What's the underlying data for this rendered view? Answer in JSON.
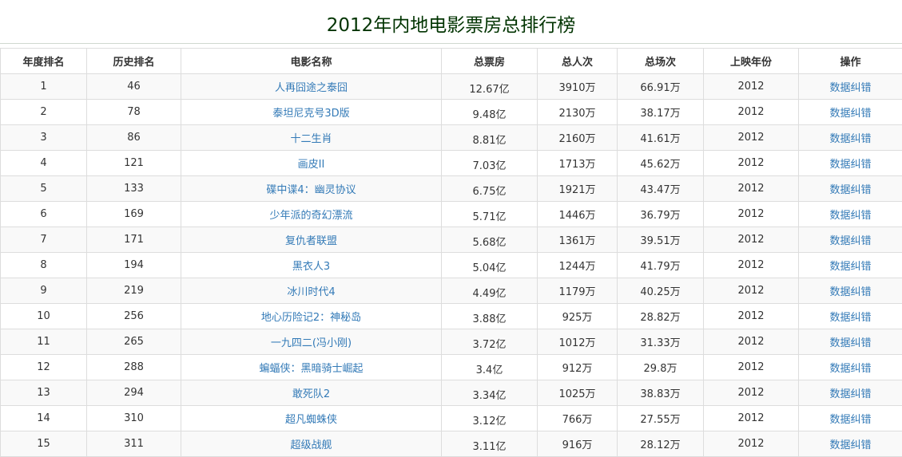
{
  "page_title": "2012年内地电影票房总排行榜",
  "headers": [
    "年度排名",
    "历史排名",
    "电影名称",
    "总票房",
    "总人次",
    "总场次",
    "上映年份",
    "操作"
  ],
  "rows": [
    {
      "rank": "1",
      "hist": "46",
      "name": "人再囧途之泰囧",
      "box": "12.67亿",
      "people": "3910万",
      "shows": "66.91万",
      "year": "2012",
      "action": "数据纠错"
    },
    {
      "rank": "2",
      "hist": "78",
      "name": "泰坦尼克号3D版",
      "box": "9.48亿",
      "people": "2130万",
      "shows": "38.17万",
      "year": "2012",
      "action": "数据纠错"
    },
    {
      "rank": "3",
      "hist": "86",
      "name": "十二生肖",
      "box": "8.81亿",
      "people": "2160万",
      "shows": "41.61万",
      "year": "2012",
      "action": "数据纠错"
    },
    {
      "rank": "4",
      "hist": "121",
      "name": "画皮II",
      "box": "7.03亿",
      "people": "1713万",
      "shows": "45.62万",
      "year": "2012",
      "action": "数据纠错"
    },
    {
      "rank": "5",
      "hist": "133",
      "name": "碟中谍4：幽灵协议",
      "box": "6.75亿",
      "people": "1921万",
      "shows": "43.47万",
      "year": "2012",
      "action": "数据纠错"
    },
    {
      "rank": "6",
      "hist": "169",
      "name": "少年派的奇幻漂流",
      "box": "5.71亿",
      "people": "1446万",
      "shows": "36.79万",
      "year": "2012",
      "action": "数据纠错"
    },
    {
      "rank": "7",
      "hist": "171",
      "name": "复仇者联盟",
      "box": "5.68亿",
      "people": "1361万",
      "shows": "39.51万",
      "year": "2012",
      "action": "数据纠错"
    },
    {
      "rank": "8",
      "hist": "194",
      "name": "黑衣人3",
      "box": "5.04亿",
      "people": "1244万",
      "shows": "41.79万",
      "year": "2012",
      "action": "数据纠错"
    },
    {
      "rank": "9",
      "hist": "219",
      "name": "冰川时代4",
      "box": "4.49亿",
      "people": "1179万",
      "shows": "40.25万",
      "year": "2012",
      "action": "数据纠错"
    },
    {
      "rank": "10",
      "hist": "256",
      "name": "地心历险记2：神秘岛",
      "box": "3.88亿",
      "people": "925万",
      "shows": "28.82万",
      "year": "2012",
      "action": "数据纠错"
    },
    {
      "rank": "11",
      "hist": "265",
      "name": "一九四二(冯小刚)",
      "box": "3.72亿",
      "people": "1012万",
      "shows": "31.33万",
      "year": "2012",
      "action": "数据纠错"
    },
    {
      "rank": "12",
      "hist": "288",
      "name": "蝙蝠侠：黑暗骑士崛起",
      "box": "3.4亿",
      "people": "912万",
      "shows": "29.8万",
      "year": "2012",
      "action": "数据纠错"
    },
    {
      "rank": "13",
      "hist": "294",
      "name": "敢死队2",
      "box": "3.34亿",
      "people": "1025万",
      "shows": "38.83万",
      "year": "2012",
      "action": "数据纠错"
    },
    {
      "rank": "14",
      "hist": "310",
      "name": "超凡蜘蛛侠",
      "box": "3.12亿",
      "people": "766万",
      "shows": "27.55万",
      "year": "2012",
      "action": "数据纠错"
    },
    {
      "rank": "15",
      "hist": "311",
      "name": "超级战舰",
      "box": "3.11亿",
      "people": "916万",
      "shows": "28.12万",
      "year": "2012",
      "action": "数据纠错"
    }
  ]
}
